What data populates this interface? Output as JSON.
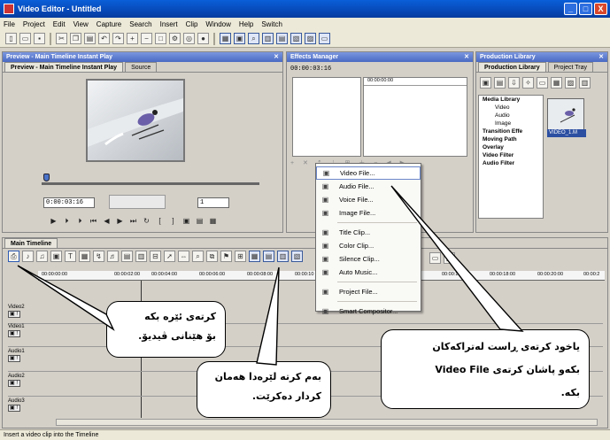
{
  "window": {
    "title": "Video Editor - Untitled",
    "controls": [
      "_",
      "□",
      "X"
    ]
  },
  "menu": [
    "File",
    "Project",
    "Edit",
    "View",
    "Capture",
    "Search",
    "Insert",
    "Clip",
    "Window",
    "Help",
    "Switch"
  ],
  "preview_panel": {
    "header": "Preview - Main Timeline Instant Play",
    "tabs": [
      "Preview - Main Timeline Instant Play",
      "Source"
    ],
    "timecode": "0:00:03:16",
    "small_value": "1"
  },
  "effects_panel": {
    "header": "Effects Manager",
    "timecode": "00:00:03:16",
    "ruler_time": "00:00:00:00"
  },
  "library_panel": {
    "header": "Production Library",
    "tabs": [
      "Production Library",
      "Project Tray"
    ],
    "tree": [
      {
        "label": "Media Library",
        "bold": true,
        "indent": 0
      },
      {
        "label": "Video",
        "bold": false,
        "indent": 1
      },
      {
        "label": "Audio",
        "bold": false,
        "indent": 1
      },
      {
        "label": "Image",
        "bold": false,
        "indent": 1
      },
      {
        "label": "Transition Effe",
        "bold": true,
        "indent": 0
      },
      {
        "label": "Moving Path",
        "bold": true,
        "indent": 0
      },
      {
        "label": "Overlay",
        "bold": true,
        "indent": 0
      },
      {
        "label": "Video Filter",
        "bold": true,
        "indent": 0
      },
      {
        "label": "Audio Filter",
        "bold": true,
        "indent": 0
      }
    ],
    "thumbnail_label": "VIDEO_1.M"
  },
  "timeline": {
    "tab": "Main Timeline",
    "ruler": [
      "00:00:00:00",
      "00:00:02:00",
      "00:00:04:00",
      "00:00:06:00",
      "00:00:08:00",
      "00:00:10",
      "00:00:16:00",
      "00:00:18:00",
      "00:00:20:00",
      "00:00:2"
    ],
    "tracks": [
      "Video2",
      "Video1",
      "Audio1",
      "Audio2",
      "Audio3"
    ]
  },
  "context_menu": [
    {
      "label": "Video File...",
      "icon": "film-icon",
      "selected": true
    },
    {
      "label": "Audio File...",
      "icon": "note-icon",
      "selected": false
    },
    {
      "label": "Voice File...",
      "icon": "mic-icon",
      "selected": false
    },
    {
      "label": "Image File...",
      "icon": "image-icon",
      "selected": false
    },
    {
      "sep": true
    },
    {
      "label": "Title Clip...",
      "icon": "text-icon",
      "selected": false
    },
    {
      "label": "Color Clip...",
      "icon": "palette-icon",
      "selected": false
    },
    {
      "label": "Silence Clip...",
      "icon": "silence-icon",
      "selected": false
    },
    {
      "label": "Auto Music...",
      "icon": "music-icon",
      "selected": false
    },
    {
      "sep": true
    },
    {
      "label": "Project File...",
      "icon": "project-icon",
      "selected": false
    },
    {
      "sep": true
    },
    {
      "label": "Smart Compositor...",
      "icon": "compositor-icon",
      "selected": false
    }
  ],
  "callouts": {
    "left": [
      "کرتەی ئێرە بکە",
      "بۆ هێنانی ڤیدیۆ."
    ],
    "middle": [
      "بەم کرتە لێرەدا هەمان",
      "کردار دەکرێت."
    ],
    "right": [
      "یاخود کرتەی ڕاست لەتراکەکان",
      "بکەو پاشان کرتەی Video File",
      "بکە."
    ]
  },
  "status_bar": "Insert a video clip into the Timeline"
}
